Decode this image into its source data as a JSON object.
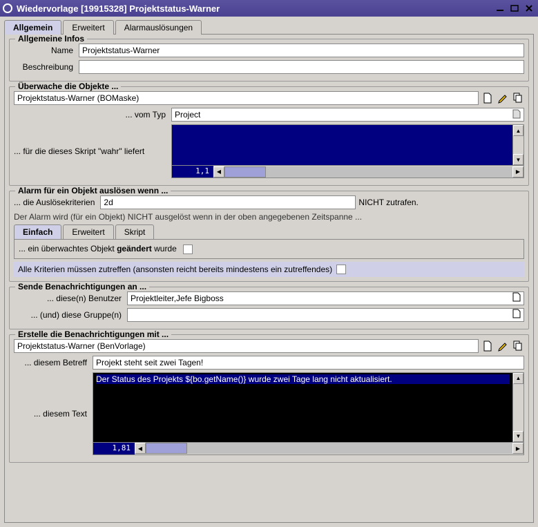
{
  "window": {
    "title": "Wiedervorlage [19915328] Projektstatus-Warner"
  },
  "tabs": {
    "t0": "Allgemein",
    "t1": "Erweitert",
    "t2": "Alarmauslösungen"
  },
  "grp": {
    "info": "Allgemeine Infos",
    "watch": "Überwache die Objekte ...",
    "alarm": "Alarm für ein Objekt auslösen wenn ...",
    "send": "Sende Benachrichtigungen an ...",
    "create": "Erstelle die Benachrichtigungen mit ..."
  },
  "info": {
    "name_lbl": "Name",
    "name_val": "Projektstatus-Warner",
    "desc_lbl": "Beschreibung",
    "desc_val": ""
  },
  "watch": {
    "file": "Projektstatus-Warner (BOMaske)",
    "type_lbl": "... vom Typ",
    "type_val": "Project",
    "script_lbl": "... für die dieses Skript \"wahr\" liefert",
    "pos": "1,1"
  },
  "alarm": {
    "crit_lbl": "... die Auslösekriterien",
    "crit_val": "2d",
    "crit_suffix": "NICHT zutrafen.",
    "note": "Der Alarm wird (für ein Objekt) NICHT ausgelöst wenn in der oben angegebenen Zeitspanne ...",
    "subtabs": {
      "t0": "Einfach",
      "t1": "Erweitert",
      "t2": "Skript"
    },
    "simple_pre": "... ein überwachtes Objekt ",
    "simple_bold": "geändert",
    "simple_post": " wurde",
    "all": "Alle Kriterien müssen zutreffen (ansonsten reicht bereits mindestens ein zutreffendes)"
  },
  "send": {
    "user_lbl": "... diese(n) Benutzer",
    "user_val": "Projektleiter,Jefe Bigboss",
    "group_lbl": "... (und) diese Gruppe(n)",
    "group_val": ""
  },
  "create": {
    "file": "Projektstatus-Warner (BenVorlage)",
    "subj_lbl": "... diesem Betreff",
    "subj_val": "Projekt steht seit zwei Tagen!",
    "text_lbl": "... diesem Text",
    "text_val": "Der Status des Projekts ${bo.getName()} wurde zwei Tage lang nicht aktualisiert.",
    "pos": "1,81"
  }
}
